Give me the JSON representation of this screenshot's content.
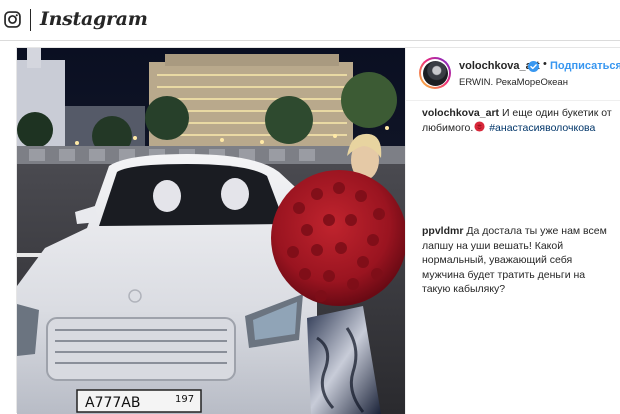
{
  "header": {
    "icon": "instagram-glyph-icon",
    "wordmark": "Instagram"
  },
  "post": {
    "author": {
      "username": "volochkova_art",
      "verified": true,
      "verified_icon": "verified-badge-icon",
      "separator": "•",
      "follow_label": "Подписаться",
      "location": "ERWIN. РекаМореОкеан"
    },
    "caption": {
      "username": "volochkova_art",
      "text_before": "И еще один букетик от любимого.",
      "emoji": "rose-emoji-icon",
      "hashtag": "#анастасияволочкова"
    },
    "comments": [
      {
        "username": "ppvldmr",
        "text": "Да достала ты уже нам всем лапшу на уши вешать! Какой нормальный, уважающий себя мужчина будет тратить деньги на такую кабыляку?"
      }
    ],
    "photo": {
      "icon": "post-photo",
      "license_plate": "А777АВ",
      "plate_region": "197"
    }
  },
  "colors": {
    "link_blue": "#3897f0",
    "hashtag_blue": "#003569",
    "text": "#262626",
    "border": "#dbdbdb"
  }
}
